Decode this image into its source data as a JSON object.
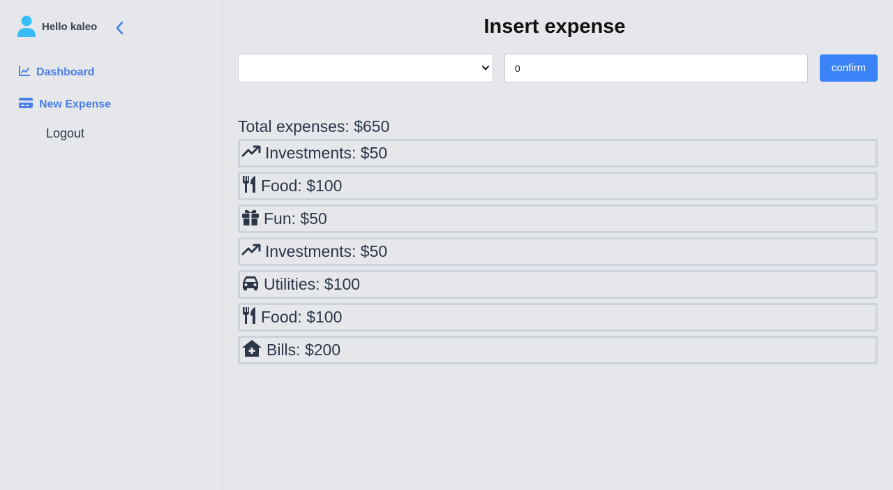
{
  "sidebar": {
    "greeting": "Hello kaleo",
    "nav": [
      {
        "label": "Dashboard",
        "icon": "chart-line-icon"
      },
      {
        "label": "New Expense",
        "icon": "credit-card-icon"
      },
      {
        "label": "Logout"
      }
    ]
  },
  "main": {
    "title": "Insert expense",
    "category_select": {
      "selected": ""
    },
    "amount_input": {
      "value": "0"
    },
    "confirm_label": "confirm",
    "total": "Total expenses: $650",
    "expenses": [
      {
        "label": "Investments: $50",
        "icon": "trending-up-icon"
      },
      {
        "label": "Food: $100",
        "icon": "utensils-icon"
      },
      {
        "label": "Fun: $50",
        "icon": "gift-icon"
      },
      {
        "label": "Investments: $50",
        "icon": "trending-up-icon"
      },
      {
        "label": "Utilities: $100",
        "icon": "car-icon"
      },
      {
        "label": "Food: $100",
        "icon": "utensils-icon"
      },
      {
        "label": "Bills: $200",
        "icon": "house-medical-icon"
      }
    ]
  },
  "colors": {
    "accent": "#3b82f6",
    "nav_text": "#4a7ee8",
    "avatar": "#38bdf8",
    "background": "#e5e7eb"
  }
}
